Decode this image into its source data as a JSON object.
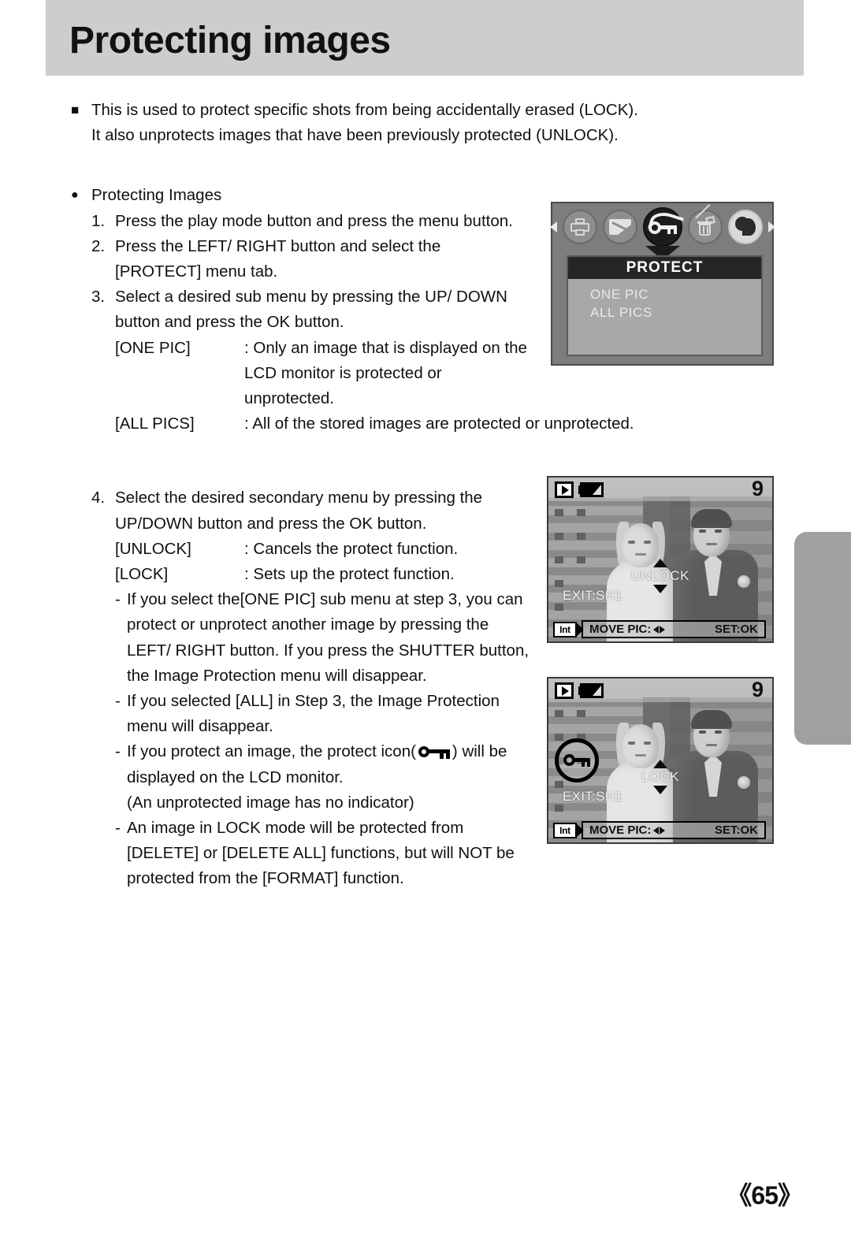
{
  "page": {
    "title": "Protecting images",
    "number": "《65》"
  },
  "intro": {
    "bullet_square": "■",
    "line1": "This is used to protect specific shots from being accidentally erased (LOCK).",
    "line2": "It also unprotects images that have been previously protected (UNLOCK)."
  },
  "section": {
    "bullet_round": "●",
    "heading": "Protecting Images"
  },
  "steps": [
    {
      "num": "1.",
      "lines": [
        "Press the play mode button and press the menu button."
      ]
    },
    {
      "num": "2.",
      "lines": [
        "Press the LEFT/ RIGHT button and select the",
        "[PROTECT] menu tab."
      ]
    },
    {
      "num": "3.",
      "lines": [
        "Select a desired sub menu by pressing the UP/ DOWN",
        "button and press the OK button."
      ]
    }
  ],
  "defs_step3": [
    {
      "term": "[ONE PIC]",
      "desc": ": Only an image that is displayed on the",
      "cont": [
        "LCD monitor is protected or",
        "unprotected."
      ]
    },
    {
      "term": "[ALL PICS]",
      "desc": ": All of the stored images are protected or unprotected.",
      "cont": []
    }
  ],
  "step4": {
    "num": "4.",
    "lines": [
      "Select the desired secondary menu by pressing the",
      "UP/DOWN button and press the OK button."
    ]
  },
  "defs_step4": [
    {
      "term": "[UNLOCK]",
      "desc": ": Cancels the protect function."
    },
    {
      "term": "[LOCK]",
      "desc": ": Sets up the protect function."
    }
  ],
  "notes": [
    {
      "dash": "-",
      "lines": [
        "If you select the[ONE PIC] sub menu at step 3, you can",
        "protect or unprotect another image by pressing the",
        "LEFT/ RIGHT button. If you press the SHUTTER button,",
        "the Image Protection menu will disappear."
      ]
    },
    {
      "dash": "-",
      "lines": [
        "If you selected [ALL] in Step 3, the Image Protection",
        "menu will disappear."
      ]
    },
    {
      "dash": "-",
      "icon_line_before": "If you protect an image, the protect icon(",
      "icon_name": "protect-key-icon",
      "icon_line_after": ") will be",
      "lines": [
        "displayed on the LCD monitor.",
        "(An unprotected image has no indicator)"
      ]
    },
    {
      "dash": "-",
      "lines": [
        "An image in LOCK mode will be protected from",
        "[DELETE] or [DELETE ALL] functions, but will NOT be",
        "protected from the [FORMAT] function."
      ]
    }
  ],
  "lcd_menu": {
    "tabs": [
      {
        "name": "print-tab-icon",
        "selected": false
      },
      {
        "name": "resize-tab-icon",
        "selected": false
      },
      {
        "name": "protect-tab-icon",
        "selected": true
      },
      {
        "name": "delete-tab-icon",
        "selected": false
      },
      {
        "name": "slideshow-tab-icon",
        "selected": false
      }
    ],
    "left_arrow": "◀",
    "right_arrow": "▶",
    "title": "PROTECT",
    "items": [
      "ONE PIC",
      "ALL PICS"
    ]
  },
  "lcd_unlock": {
    "count": "9",
    "mode_label": "UNLOCK",
    "exit_label": "EXIT:SH1",
    "memory_label": "Int",
    "move_label": "MOVE PIC:",
    "set_label": "SET:OK",
    "has_protect_indicator": false
  },
  "lcd_lock": {
    "count": "9",
    "mode_label": "LOCK",
    "exit_label": "EXIT:SH1",
    "memory_label": "Int",
    "move_label": "MOVE PIC:",
    "set_label": "SET:OK",
    "has_protect_indicator": true
  },
  "colors": {
    "header_bg": "#cdcdcd",
    "edge_tab": "#a0a0a0",
    "lcd_bg": "#7d7d7d",
    "menu_title_bg": "#262626",
    "menu_panel_bg": "#a8a8a8"
  }
}
